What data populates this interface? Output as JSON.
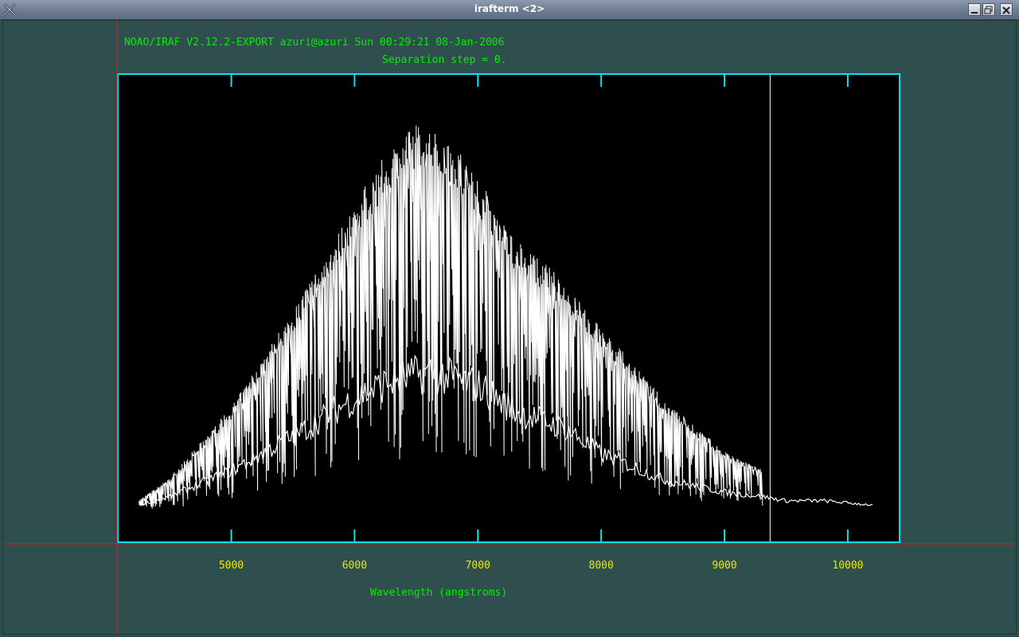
{
  "window": {
    "title": "irafterm <2>",
    "buttons": [
      "minimize",
      "maximize",
      "close"
    ]
  },
  "header": {
    "line1": "NOAO/IRAF V2.12.2-EXPORT azuri@azuri Sun 00:29:21 08-Jan-2006",
    "line2": "Separation step = 0."
  },
  "colors": {
    "background": "#2f4f4f",
    "frame": "#00e5ee",
    "text": "#00ee00",
    "tick_labels": "#e8e800",
    "crosshair": "#cc2222",
    "spectrum": "#ffffff"
  },
  "chart_data": {
    "type": "line",
    "title": "",
    "xlabel": "Wavelength (angstroms)",
    "ylabel": "",
    "xlim": [
      4080,
      10420
    ],
    "ylim": [
      0,
      1
    ],
    "xticks": [
      5000,
      6000,
      7000,
      8000,
      9000,
      10000
    ],
    "grid": false,
    "marker_line_x": 9370,
    "series": [
      {
        "x": [
          4250,
          4500,
          5000,
          5500,
          6000,
          6300,
          6500,
          6800,
          7000,
          7300,
          7600,
          8000,
          8500,
          9000,
          9300
        ],
        "values": [
          0.03,
          0.08,
          0.24,
          0.46,
          0.7,
          0.83,
          0.88,
          0.84,
          0.76,
          0.62,
          0.55,
          0.42,
          0.26,
          0.14,
          0.1
        ]
      },
      {
        "x": [
          4250,
          4500,
          5000,
          5500,
          6000,
          6300,
          6600,
          7000,
          7300,
          7700,
          8000,
          8500,
          9000,
          9300,
          9500,
          9800,
          10200
        ],
        "values": [
          0.02,
          0.04,
          0.1,
          0.18,
          0.27,
          0.31,
          0.33,
          0.3,
          0.24,
          0.2,
          0.14,
          0.08,
          0.05,
          0.04,
          0.03,
          0.03,
          0.02
        ]
      }
    ]
  }
}
